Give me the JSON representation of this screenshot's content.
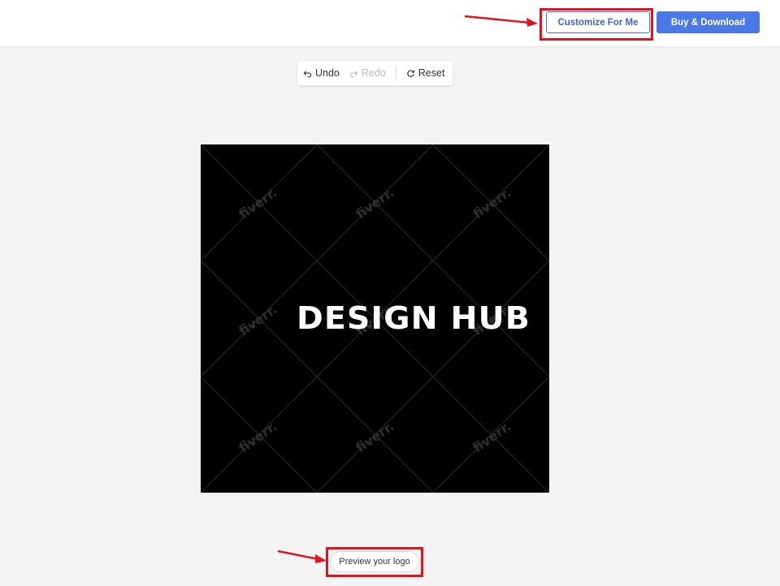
{
  "header": {
    "customize_label": "Customize For Me",
    "buy_label": "Buy & Download"
  },
  "toolbar": {
    "undo_label": "Undo",
    "redo_label": "Redo",
    "reset_label": "Reset"
  },
  "canvas": {
    "logo_text": "DESIGN HUB",
    "watermark_text": "fiverr."
  },
  "footer": {
    "preview_label": "Preview your logo"
  },
  "colors": {
    "accent": "#4a78e8",
    "highlight": "#e0141e",
    "canvas_bg": "#000000"
  }
}
